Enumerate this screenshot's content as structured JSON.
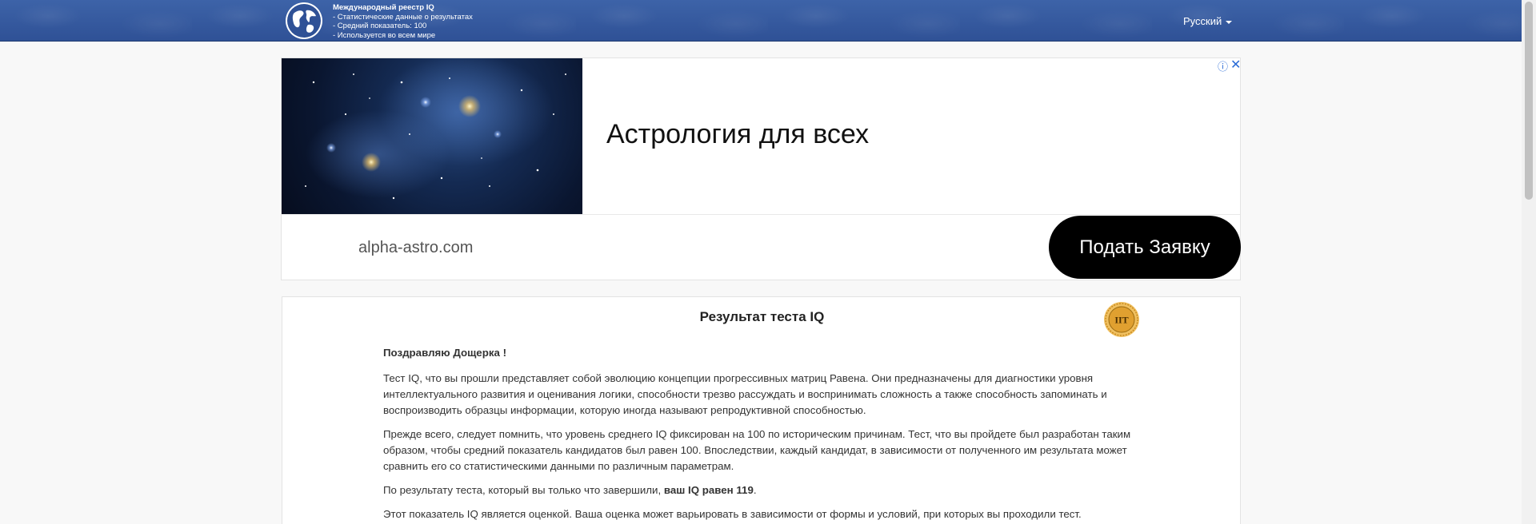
{
  "header": {
    "brand_title": "Международный реестр IQ",
    "brand_lines": [
      "- Статистические данные о результатах",
      "- Средний показатель: 100",
      "- Используется во всем мире"
    ],
    "language": "Русский"
  },
  "ad": {
    "headline": "Астрология для всех",
    "domain": "alpha-astro.com",
    "cta": "Подать Заявку",
    "info_icon": "ⓘ",
    "close_icon": "✕"
  },
  "result": {
    "title": "Результат теста IQ",
    "badge_text": "IIT",
    "greeting": "Поздравляю Дощерка !",
    "para1": "Тест IQ, что вы прошли представляет собой эволюцию концепции прогрессивных матриц Равена. Они предназначены для диагностики уровня интеллектуального развития и оценивания логики, способности трезво рассуждать и воспринимать сложность а также способность запоминать и воспроизводить образцы информации, которую иногда называют репродуктивной способностью.",
    "para2": "Прежде всего, следует помнить, что уровень среднего IQ фиксирован на 100 по историческим причинам. Тест, что вы пройдете был разработан таким образом, чтобы средний показатель кандидатов был равен 100. Впоследствии, каждый кандидат, в зависимости от полученного им результата может сравнить его со статистическими данными по различным параметрам.",
    "para3_prefix": "По результату теста, который вы только что завершили, ",
    "para3_bold": "ваш IQ равен 119",
    "para3_suffix": ".",
    "para4": "Этот показатель IQ является оценкой. Ваша оценка может варьировать в зависимости от формы и условий, при которых вы проходили тест."
  },
  "colors": {
    "header_bg": "#2f5196",
    "cta_bg": "#000000",
    "ad_icon": "#2a6bd6",
    "badge_gold": "#e0a030"
  }
}
